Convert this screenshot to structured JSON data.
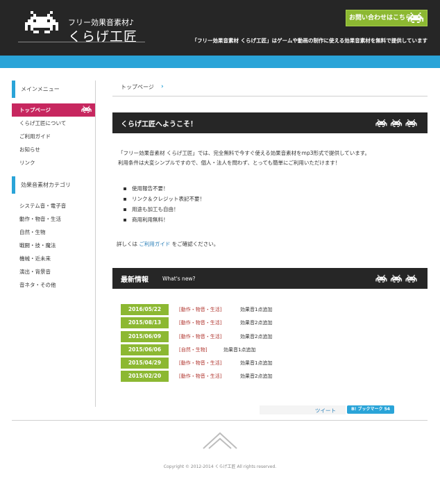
{
  "header": {
    "logo_sub": "フリー効果音素材♪",
    "logo_main": "くらげ工匠",
    "contact": "お問い合わせはこちら",
    "tagline": "「フリー効果音素材 くらげ工匠」はゲームや動画の制作に使える効果音素材を無料で提供しています"
  },
  "colors": {
    "dark": "#262626",
    "blue": "#2aa4d8",
    "green": "#8cb832",
    "pink": "#c7275f"
  },
  "sidebar": {
    "main_heading": "メインメニュー",
    "main_items": [
      {
        "label": "トップページ",
        "active": true
      },
      {
        "label": "くらげ工匠について"
      },
      {
        "label": "ご利用ガイド"
      },
      {
        "label": "お知らせ"
      },
      {
        "label": "リンク"
      }
    ],
    "cat_heading": "効果音素材カテゴリ",
    "cat_items": [
      {
        "label": "システム音・電子音"
      },
      {
        "label": "動作・物音・生活"
      },
      {
        "label": "自然・生物"
      },
      {
        "label": "戦闘・技・魔法"
      },
      {
        "label": "機械・近未来"
      },
      {
        "label": "演出・背景音"
      },
      {
        "label": "音ネタ・その他"
      }
    ]
  },
  "main": {
    "breadcrumb": "トップページ",
    "welcome_title": "くらげ工匠へようこそ！",
    "intro_line1": "「フリー効果音素材 くらげ工匠」では、完全無料で今すぐ使える効果音素材をmp3形式で提供しています。",
    "intro_line2": "利用条件は大変シンプルですので、個人・法人を問わず、とっても簡単にご利用いただけます！",
    "features": [
      "使用報告不要！",
      "リンク＆クレジット表記不要！",
      "用途も加工も自由！",
      "商用利用無料！"
    ],
    "guide_pre": "詳しくは",
    "guide_link": "ご利用ガイド",
    "guide_post": "をご確認ください。",
    "news_title": "最新情報",
    "news_sub": "What's new?",
    "news": [
      {
        "date": "2016/05/22",
        "category": "[動作・物音・生活]",
        "text": "効果音1点追加"
      },
      {
        "date": "2015/08/13",
        "category": "[動作・物音・生活]",
        "text": "効果音2点追加"
      },
      {
        "date": "2015/06/09",
        "category": "[動作・物音・生活]",
        "text": "効果音2点追加"
      },
      {
        "date": "2015/06/06",
        "category": "[自然・生物]",
        "text": "効果音1点追加"
      },
      {
        "date": "2015/04/29",
        "category": "[動作・物音・生活]",
        "text": "効果音1点追加"
      },
      {
        "date": "2015/02/20",
        "category": "[動作・物音・生活]",
        "text": "効果音2点追加"
      }
    ]
  },
  "footer": {
    "tweet": "ツイート",
    "hatebu": "B! ブックマーク 54",
    "copyright": "Copyright © 2012-2014 くらげ工匠 All rights reserved."
  }
}
